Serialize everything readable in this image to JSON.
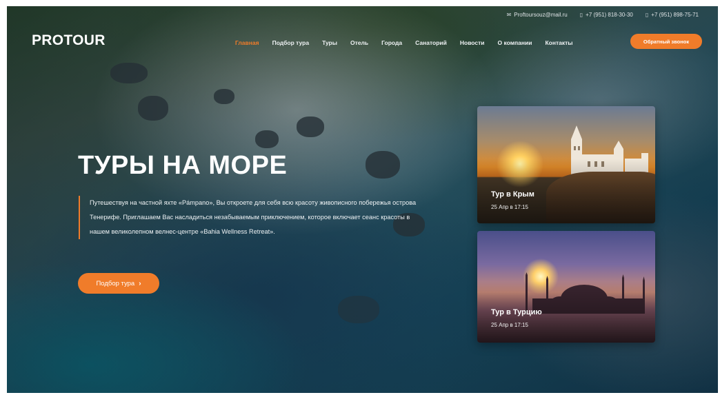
{
  "brand": {
    "logo_text": "PROTOUR"
  },
  "topbar": {
    "email": "Proftoursouz@mail.ru",
    "phone1": "+7 (951) 818-30-30",
    "phone2": "+7 (951) 898-75-71"
  },
  "nav": {
    "items": [
      {
        "label": "Главная",
        "active": true
      },
      {
        "label": "Подбор тура",
        "active": false
      },
      {
        "label": "Туры",
        "active": false
      },
      {
        "label": "Отель",
        "active": false
      },
      {
        "label": "Города",
        "active": false
      },
      {
        "label": "Санаторий",
        "active": false
      },
      {
        "label": "Новости",
        "active": false
      },
      {
        "label": "О компании",
        "active": false
      },
      {
        "label": "Контакты",
        "active": false
      }
    ],
    "callback_label": "Обратный звонок"
  },
  "hero": {
    "title": "ТУРЫ НА МОРЕ",
    "description": "Путешествуя на частной яхте «Pámpano», Вы откроете для себя всю красоту живописного побережья острова Тенерифе. Приглашаем Вас насладиться незабываемым приключением, которое включает сеанс красоты в нашем великолепном велнес-центре «Bahia Wellness Retreat».",
    "cta_label": "Подбор тура",
    "cta_icon": "chevron-right-icon"
  },
  "cards": [
    {
      "title": "Тур в Крым",
      "date": "25 Апр в 17:15"
    },
    {
      "title": "Тур в Турцию",
      "date": "25 Апр в 17:15"
    }
  ],
  "colors": {
    "accent": "#f07c2a",
    "text": "#ffffff"
  }
}
